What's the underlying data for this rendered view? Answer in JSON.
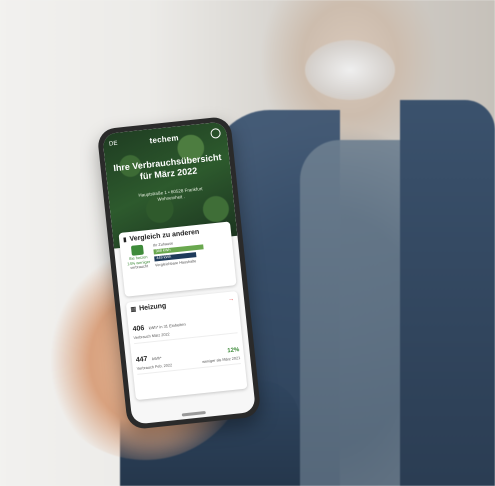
{
  "app": {
    "lang": "DE",
    "logo": "techem"
  },
  "hero": {
    "title": "Ihre Verbrauchsübersicht für März 2022",
    "subtitle_line1": "Hauptstraße 1 • 60528 Frankfurt",
    "subtitle_line2": "Wohneinheit ."
  },
  "comparison": {
    "title": "Vergleich zu anderen",
    "label_you": "Sie heizen",
    "label_less": "14% weniger",
    "label_rest": "verbraucht",
    "your_usage_label": "Ihr Zuhause",
    "bar1_value": "388 kWh",
    "bar2_value": "449 kWh",
    "avg_label": "Vergleichbare Haushalte"
  },
  "heating": {
    "title": "Heizung",
    "value1": "406",
    "unit1": "kWh* in 31 Einheiten",
    "row1_sub": "Verbrauch März 2022",
    "value2": "447",
    "unit2": "kWh*",
    "row2_sub": "Verbrauch Feb. 2022",
    "change_pct": "12%",
    "change_label": "weniger als März 2021"
  },
  "colors": {
    "accent_green": "#3e8b3a",
    "navy": "#1e3a5a",
    "alert_red": "#e03a3a"
  }
}
